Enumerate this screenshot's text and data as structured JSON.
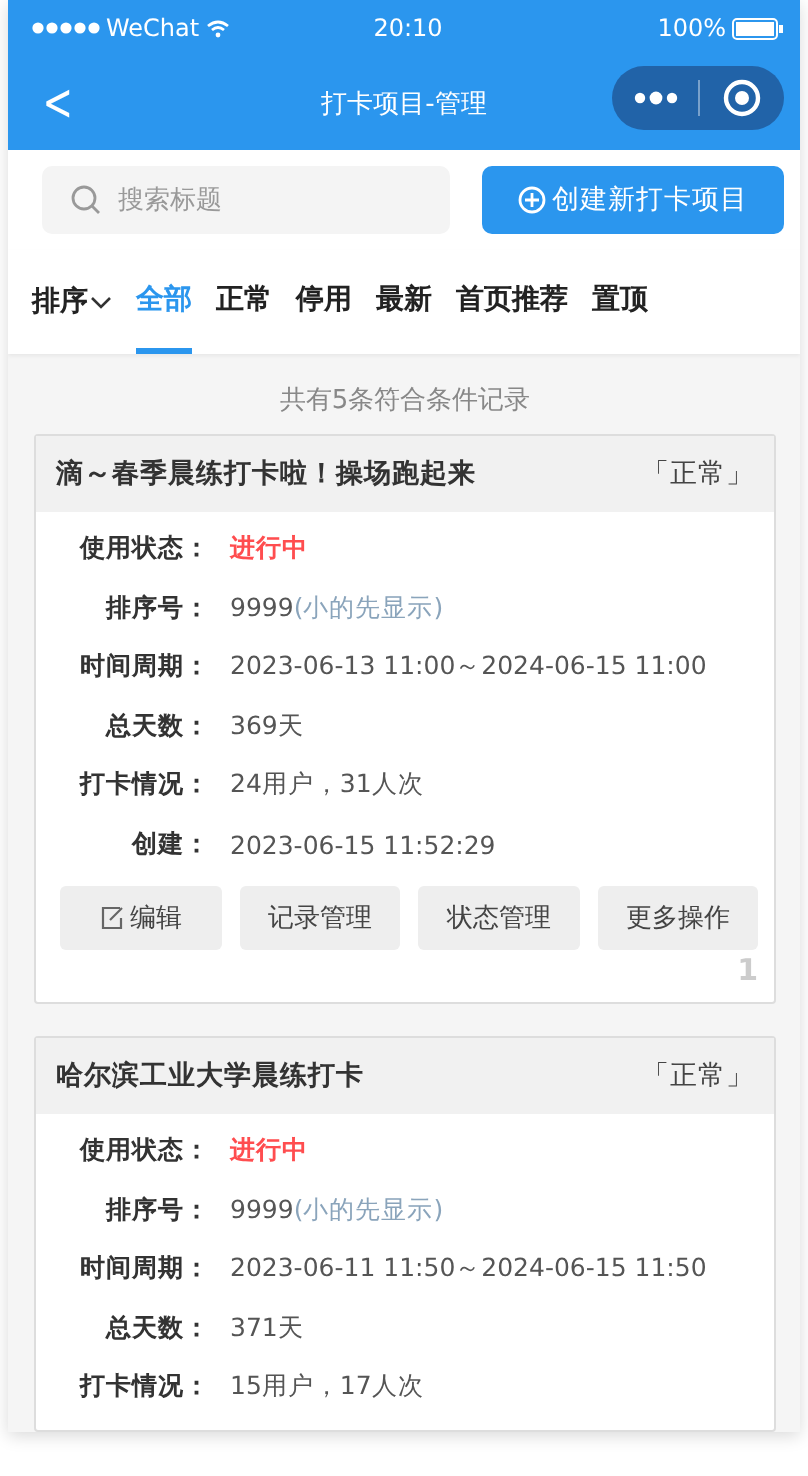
{
  "status_bar": {
    "carrier": "WeChat",
    "time": "20:10",
    "battery_text": "100%"
  },
  "nav": {
    "back": "<",
    "title": "打卡项目-管理"
  },
  "search": {
    "placeholder": "搜索标题"
  },
  "create_button": {
    "label": "创建新打卡项目"
  },
  "sort": {
    "label": "排序"
  },
  "tabs": [
    {
      "label": "全部",
      "selected": true
    },
    {
      "label": "正常",
      "selected": false
    },
    {
      "label": "停用",
      "selected": false
    },
    {
      "label": "最新",
      "selected": false
    },
    {
      "label": "首页推荐",
      "selected": false
    },
    {
      "label": "置顶",
      "selected": false
    }
  ],
  "summary": "共有5条符合条件记录",
  "cards": [
    {
      "title": "滴～春季晨练打卡啦！操场跑起来",
      "tag": "「正常」",
      "fields": [
        {
          "kind": "status",
          "label": "使用状态：",
          "value": "进行中"
        },
        {
          "kind": "sort",
          "label": "排序号：",
          "value": "9999",
          "note": "(小的先显示)"
        },
        {
          "kind": "text",
          "label": "时间周期：",
          "value": "2023-06-13 11:00～2024-06-15 11:00"
        },
        {
          "kind": "text",
          "label": "总天数：",
          "value": "369天"
        },
        {
          "kind": "text",
          "label": "打卡情况：",
          "value": "24用户，31人次"
        },
        {
          "kind": "text",
          "label": "创建：",
          "value": "2023-06-15 11:52:29"
        }
      ],
      "buttons": [
        "编辑",
        "记录管理",
        "状态管理",
        "更多操作"
      ],
      "index": "1"
    },
    {
      "title": "哈尔滨工业大学晨练打卡",
      "tag": "「正常」",
      "fields": [
        {
          "kind": "status",
          "label": "使用状态：",
          "value": "进行中"
        },
        {
          "kind": "sort",
          "label": "排序号：",
          "value": "9999",
          "note": "(小的先显示)"
        },
        {
          "kind": "text",
          "label": "时间周期：",
          "value": "2023-06-11 11:50～2024-06-15 11:50"
        },
        {
          "kind": "text",
          "label": "总天数：",
          "value": "371天"
        },
        {
          "kind": "text",
          "label": "打卡情况：",
          "value": "15用户，17人次"
        }
      ]
    }
  ]
}
